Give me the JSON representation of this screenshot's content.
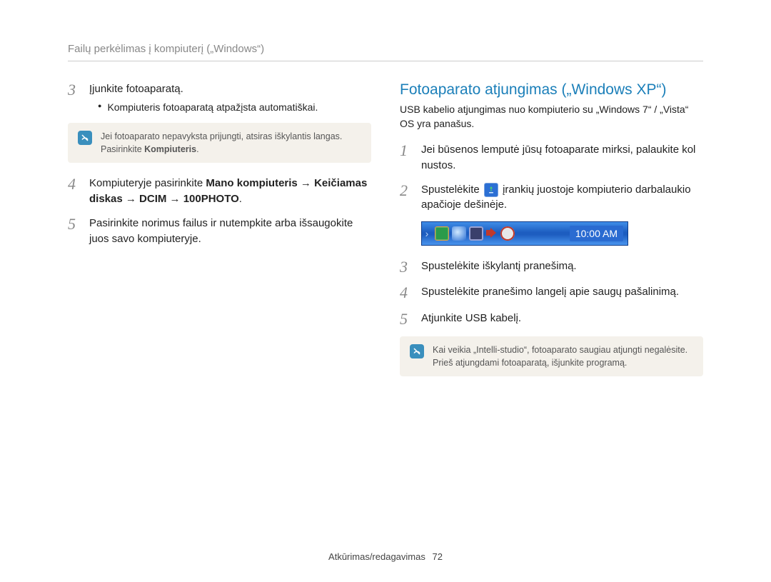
{
  "header": "Failų perkėlimas į kompiuterį („Windows“)",
  "left": {
    "step3": {
      "num": "3",
      "text": "Įjunkite fotoaparatą.",
      "bullet": "Kompiuteris fotoaparatą atpažįsta automatiškai."
    },
    "note1_a": "Jei fotoaparato nepavyksta prijungti, atsiras iškylantis langas. Pasirinkite ",
    "note1_b": "Kompiuteris",
    "note1_c": ".",
    "step4": {
      "num": "4",
      "pre": "Kompiuteryje pasirinkite ",
      "bold": "Mano kompiuteris → Keičiamas diskas → DCIM → 100PHOTO",
      "post": "."
    },
    "step5": {
      "num": "5",
      "text": "Pasirinkite norimus failus ir nutempkite arba išsaugokite juos savo kompiuteryje."
    }
  },
  "right": {
    "title": "Fotoaparato atjungimas („Windows XP“)",
    "sub": "USB kabelio atjungimas nuo kompiuterio su „Windows 7“ / „Vista“ OS yra panašus.",
    "step1": {
      "num": "1",
      "text": "Jei būsenos lemputė jūsų fotoaparate mirksi, palaukite kol nustos."
    },
    "step2": {
      "num": "2",
      "pre": "Spustelėkite ",
      "post": " įrankių juostoje kompiuterio darbalaukio apačioje dešinėje."
    },
    "taskbar_time": "10:00 AM",
    "step3": {
      "num": "3",
      "text": "Spustelėkite iškylantį pranešimą."
    },
    "step4": {
      "num": "4",
      "text": "Spustelėkite pranešimo langelį apie saugų pašalinimą."
    },
    "step5": {
      "num": "5",
      "text": "Atjunkite USB kabelį."
    },
    "note2": "Kai veikia „Intelli-studio“, fotoaparato saugiau atjungti negalėsite. Prieš atjungdami fotoaparatą, išjunkite programą."
  },
  "footer": {
    "section": "Atkūrimas/redagavimas",
    "page": "72"
  }
}
